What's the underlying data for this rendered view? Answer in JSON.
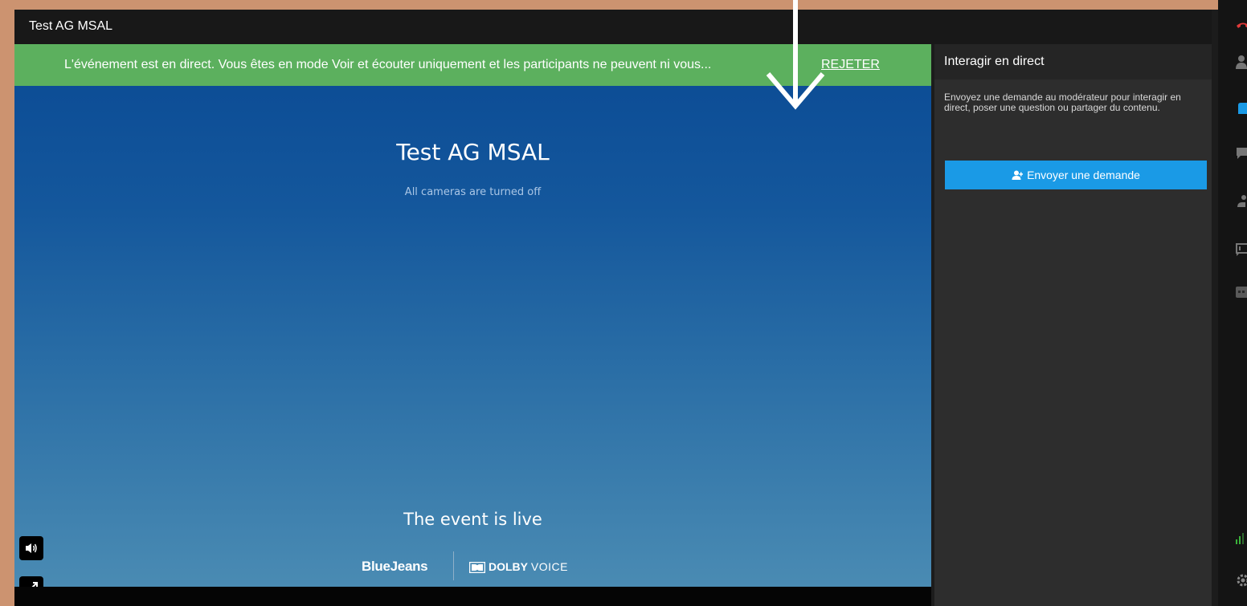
{
  "window": {
    "title": "Test AG MSAL"
  },
  "banner": {
    "message": "L'événement est en direct. Vous êtes en mode Voir et écouter uniquement et les participants ne peuvent ni vous...",
    "dismiss_label": "REJETER",
    "color": "#5cb05e"
  },
  "stage": {
    "event_title": "Test AG MSAL",
    "camera_status": "All cameras are turned off",
    "live_status": "The event is live",
    "brand_primary": "BlueJeans",
    "brand_secondary_bold": "DOLBY",
    "brand_secondary_light": "VOICE",
    "controls": [
      {
        "name": "volume-icon"
      },
      {
        "name": "fullscreen-icon"
      }
    ]
  },
  "panel": {
    "title": "Interagir en direct",
    "description": "Envoyez une demande au modérateur pour interagir en direct, poser une question ou partager du contenu.",
    "request_button": "Envoyer une demande",
    "request_button_color": "#1a9ae6"
  },
  "rail": {
    "icons": [
      "hang-up-icon",
      "people-icon",
      "raise-hand-icon",
      "chat-icon",
      "share-icon",
      "q-and-a-icon",
      "caption-icon",
      "signal-icon",
      "settings-icon"
    ]
  },
  "annotation": {
    "name": "down-arrow-overlay"
  }
}
